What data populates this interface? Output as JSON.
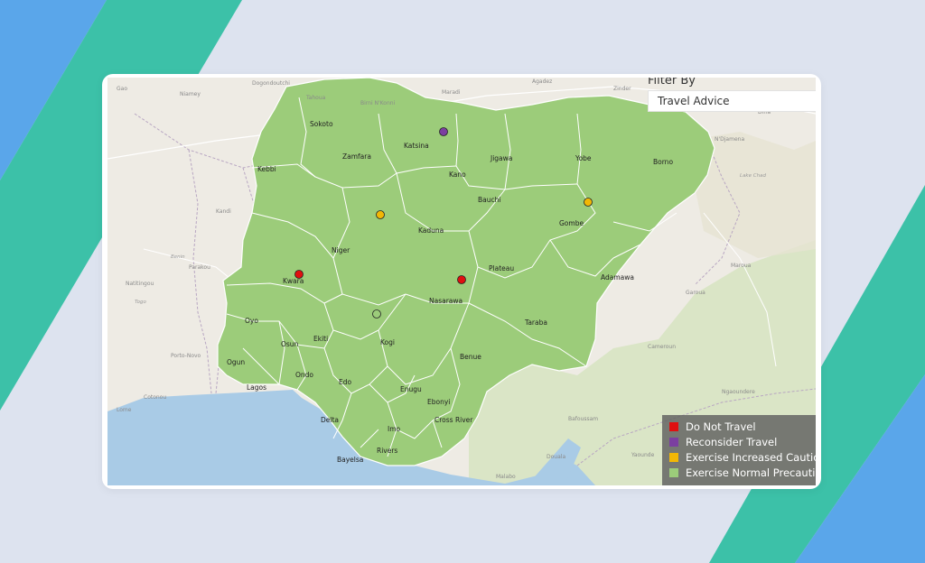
{
  "filter": {
    "label": "Filter By",
    "selected": "Travel Advice"
  },
  "legend": {
    "items": [
      {
        "label": "Do Not Travel",
        "color": "#e01010"
      },
      {
        "label": "Reconsider Travel",
        "color": "#7b3fa0"
      },
      {
        "label": "Exercise Increased Cautio",
        "color": "#f2b705"
      },
      {
        "label": "Exercise Normal Precautic",
        "color": "#9ccc7a"
      }
    ]
  },
  "colors": {
    "state_fill": "#9ccc7a",
    "border": "#ffffff",
    "water": "#a9cbe6",
    "land": "#eeebe4",
    "page_bg": "#dde3ef",
    "accent_teal": "#3cc1a8",
    "accent_blue": "#5aa6ea"
  },
  "states": [
    "Sokoto",
    "Zamfara",
    "Katsina",
    "Kano",
    "Jigawa",
    "Yobe",
    "Borno",
    "Kebbi",
    "Bauchi",
    "Gombe",
    "Kaduna",
    "Niger",
    "Plateau",
    "Adamawa",
    "Kwara",
    "Nasarawa",
    "Taraba",
    "Oyo",
    "Osun",
    "Ekiti",
    "Kogi",
    "Benue",
    "Ogun",
    "Lagos",
    "Ondo",
    "Edo",
    "Enugu",
    "Ebonyi",
    "Delta",
    "Imo",
    "Cross River",
    "Rivers",
    "Bayelsa"
  ],
  "map_labels": [
    "Gao",
    "Niamey",
    "Dogondoutchi",
    "Maradi",
    "Zinder",
    "Diffa",
    "N'Djamena",
    "Cotonou",
    "Porto-Novo",
    "Lome",
    "Togo",
    "Benin",
    "Parakou",
    "Cameroun",
    "Malabo",
    "Douala",
    "Yaounde",
    "Bafoussam",
    "Ngaoundere",
    "Garoua",
    "Maroua",
    "Lake Chad",
    "Kandi",
    "Natitingou",
    "Tahoua",
    "Birni N'Konni",
    "Agadez"
  ],
  "advisories": [
    {
      "name": "Katsina",
      "level": "Reconsider Travel"
    },
    {
      "name": "Kaduna",
      "level": "Exercise Increased Caution"
    },
    {
      "name": "Gombe",
      "level": "Exercise Increased Caution"
    },
    {
      "name": "Kwara",
      "level": "Do Not Travel"
    },
    {
      "name": "Plateau",
      "level": "Do Not Travel"
    },
    {
      "name": "Kogi",
      "level": "Exercise Normal Precautions"
    }
  ]
}
